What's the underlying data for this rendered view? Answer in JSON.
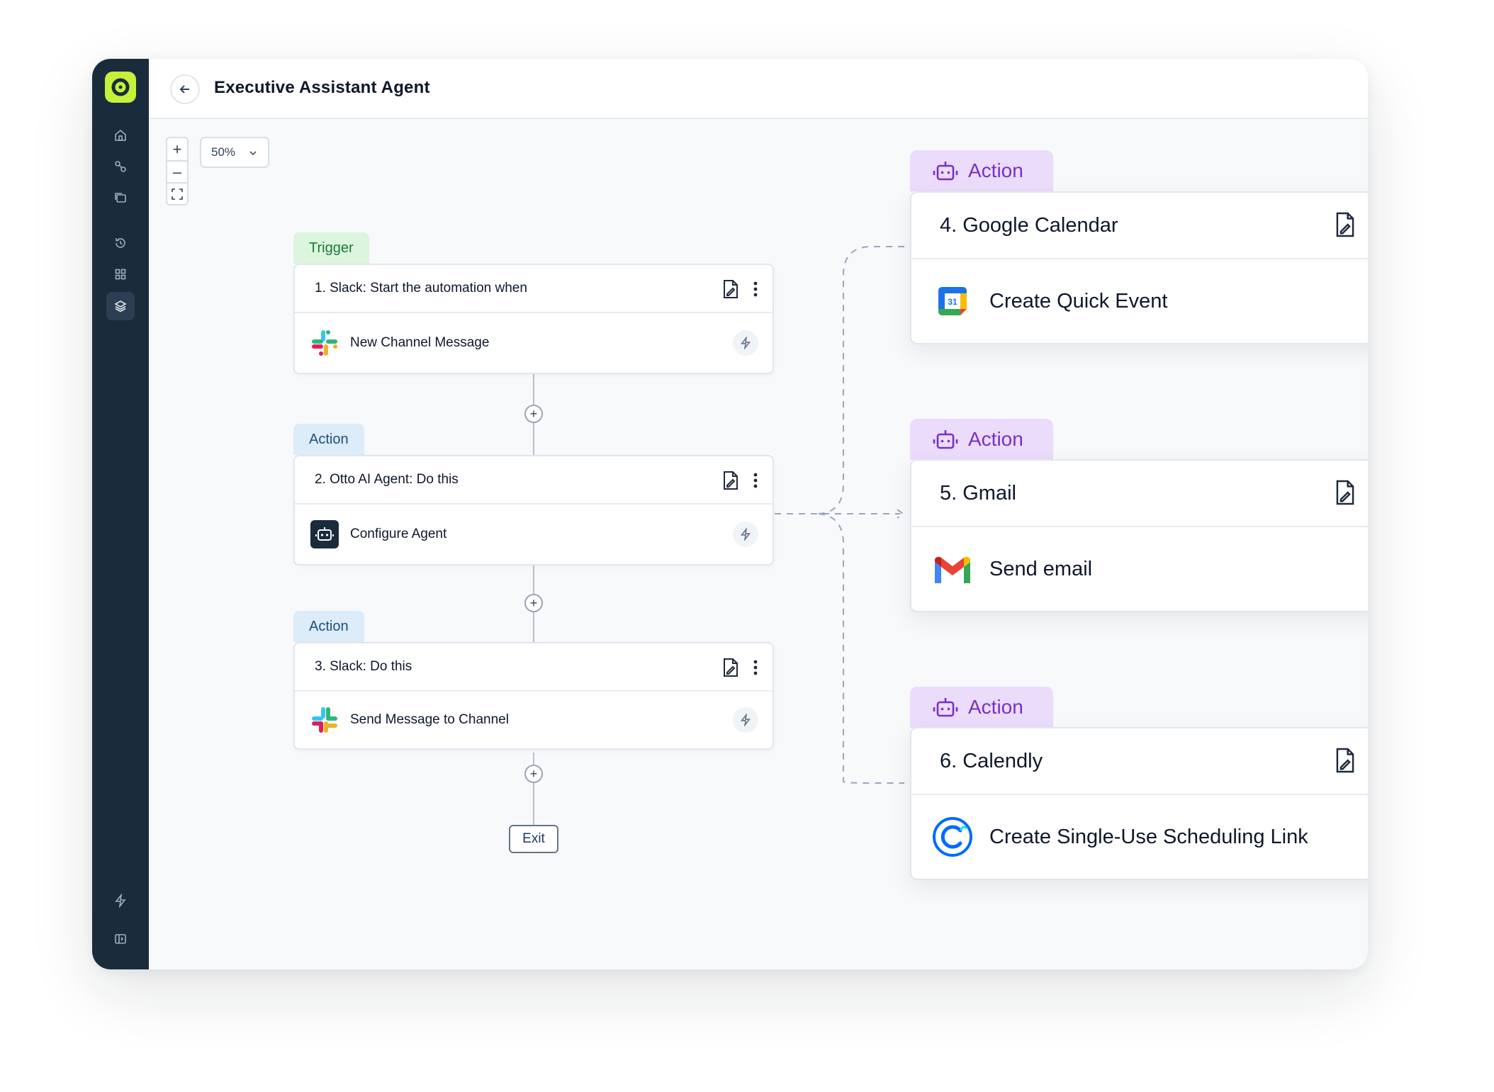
{
  "header": {
    "title": "Executive Assistant Agent"
  },
  "zoom": {
    "level": "50%",
    "zoom_in": "+",
    "zoom_out": "–"
  },
  "steps": [
    {
      "tag": "Trigger",
      "title": "1. Slack: Start the automation when",
      "app": "slack-icon",
      "event": "New Channel Message"
    },
    {
      "tag": "Action",
      "title": "2. Otto AI Agent: Do this",
      "app": "agent-icon",
      "event": "Configure Agent"
    },
    {
      "tag": "Action",
      "title": "3. Slack: Do this",
      "app": "slack-icon",
      "event": "Send Message to Channel"
    }
  ],
  "add_step": "+",
  "exit_label": "Exit",
  "branches": [
    {
      "tag": "Action",
      "title": "4. Google Calendar",
      "app": "google-calendar-icon",
      "calendar_day": "31",
      "event": "Create Quick Event"
    },
    {
      "tag": "Action",
      "title": "5. Gmail",
      "app": "gmail-icon",
      "event": "Send email"
    },
    {
      "tag": "Action",
      "title": "6. Calendly",
      "app": "calendly-icon",
      "event": "Create Single-Use Scheduling Link"
    }
  ],
  "colors": {
    "sidebar": "#1a2b3c",
    "logo": "#c6f03a",
    "trigger_tag_bg": "#dcf5dd",
    "action_tag_bg": "#dcecf8",
    "branch_tag_bg": "#eadcfa",
    "branch_tag_text": "#7a2fc6"
  }
}
